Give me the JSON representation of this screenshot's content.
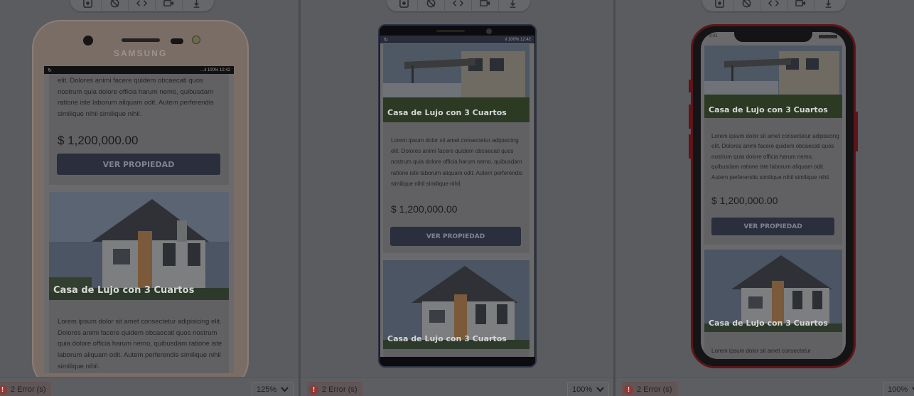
{
  "toolbar": {
    "icons": [
      "screenshot-icon",
      "rotate-icon",
      "code-icon",
      "video-icon",
      "touch-icon"
    ]
  },
  "devices": [
    {
      "name": "samsung",
      "brand": "SAMSUNG",
      "status": {
        "signal": "…ıl 100%",
        "time": "12:42"
      },
      "card1": {
        "desc_partial": "elit. Dolores animi facere quidem obcaecati quos nostrum quia dolore officia harum nemo, quibusdam ratione iste laborum aliquam odit. Autem perferendis similique nihil similique nihil.",
        "price": "$ 1,200,000.00",
        "button": "VER PROPIEDAD"
      },
      "card2": {
        "title": "Casa de Lujo con 3 Cuartos",
        "desc": "Lorem ipsum dolor sit amet consectetur adipisicing elit. Dolores animi facere quidem obcaecati quos nostrum quia dolore officia harum nemo, quibusdam ratione iste laborum aliquam odit. Autem perferendis similique nihil similique nihil."
      },
      "errors": "2 Error (s)",
      "zoom": "125%"
    },
    {
      "name": "galaxy-note",
      "status": {
        "signal": "ıl 100%",
        "time": "12:42"
      },
      "card1": {
        "title": "Casa de Lujo con 3 Cuartos",
        "desc": "Lorem ipsum dolor sit amet consectetur adipisicing elit. Dolores animi facere quidem obcaecati quos nostrum quia dolore officia harum nemo, quibusdam ratione iste laborum aliquam odit. Autem perferendis similique nihil similique nihil.",
        "price": "$ 1,200,000.00",
        "button": "VER PROPIEDAD"
      },
      "card2": {
        "title": "Casa de Lujo con 3 Cuartos"
      },
      "errors": "2 Error (s)",
      "zoom": "100%"
    },
    {
      "name": "iphone",
      "status": {
        "time": "9:41"
      },
      "card1": {
        "title": "Casa de Lujo con 3 Cuartos",
        "desc": "Lorem ipsum dolor sit amet consectetur adipisicing elit. Dolores animi facere quidem obcaecati quos nostrum quia dolore officia harum nemo, quibusdam ratione iste laborum aliquam odit. Autem perferendis similique nihil similique nihil.",
        "price": "$ 1,200,000.00",
        "button": "VER PROPIEDAD"
      },
      "card2": {
        "title": "Casa de Lujo con 3 Cuartos",
        "desc_partial": "Lorem ipsum dolor sit amet consectetur"
      },
      "errors": "2 Error (s)",
      "zoom": "100%"
    }
  ]
}
